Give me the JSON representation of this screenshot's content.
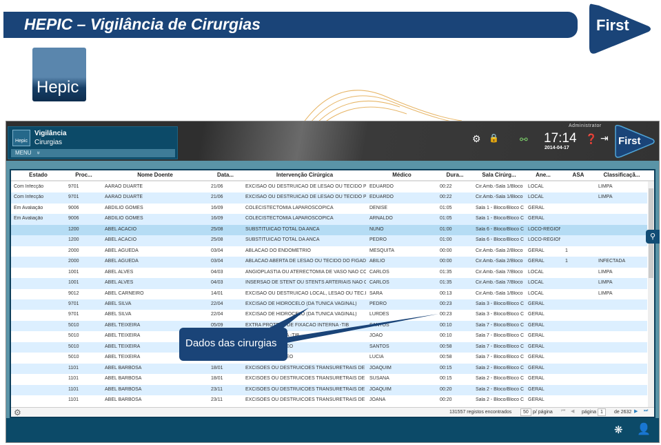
{
  "slide": {
    "title": "HEPIC – Vigilância de Cirurgias",
    "first_logo": "First",
    "hepic_logo": "Hepic",
    "callout": "Dados das cirurgias"
  },
  "app": {
    "module_icon": "Hepic",
    "module_title": "Vigilância",
    "module_subtitle": "Cirurgias",
    "menu_label": "MENU",
    "menu_chevron": "»",
    "user": "Administrator",
    "time": "17:14",
    "date": "2014-04-17",
    "logo": "First",
    "icons": [
      "gear-icon",
      "lock-icon",
      "network-icon",
      "help-icon",
      "logout-icon"
    ],
    "columns": [
      "Estado",
      "Proc...",
      "Nome Doente",
      "Data...",
      "Intervenção Cirúrgica",
      "Médico",
      "Dura...",
      "Sala Cirúrg...",
      "Ane...",
      "ASA",
      "Classificaçã..."
    ],
    "rows": [
      [
        "Com Infecção",
        "9701",
        "AARAO DUARTE",
        "21/06",
        "EXCISAO OU DESTRUICAO DE LESAO OU TECIDO PEI",
        "EDUARDO",
        "00:22",
        "Cir.Amb.-Sala 1/Bloco",
        "LOCAL",
        "",
        "LIMPA"
      ],
      [
        "Com Infecção",
        "9701",
        "AARAO DUARTE",
        "21/06",
        "EXCISAO OU DESTRUICAO DE LESAO OU TECIDO PEI",
        "EDUARDO",
        "00:22",
        "Cir.Amb.-Sala 1/Bloco",
        "LOCAL",
        "",
        "LIMPA"
      ],
      [
        "Em Avaliação",
        "9006",
        "ABDILIO GOMES",
        "16/09",
        "COLECISTECTOMIA LAPAROSCOPICA",
        "DENISE",
        "01:05",
        "Sala 1 - Bloco/Bloco C",
        "GERAL",
        "",
        ""
      ],
      [
        "Em Avaliação",
        "9006",
        "ABDILIO GOMES",
        "16/09",
        "COLECISTECTOMIA LAPAROSCOPICA",
        "ARNALDO",
        "01:05",
        "Sala 1 - Bloco/Bloco C",
        "GERAL",
        "",
        ""
      ],
      [
        "",
        "1200",
        "ABEL ACACIO",
        "25/08",
        "SUBSTITUICAO TOTAL DA ANCA",
        "NUNO",
        "01:00",
        "Sala 6 - Bloco/Bloco C",
        "LOCO-REGION",
        "",
        ""
      ],
      [
        "",
        "1200",
        "ABEL ACACIO",
        "25/08",
        "SUBSTITUICAO TOTAL DA ANCA",
        "PEDRO",
        "01:00",
        "Sala 6 - Bloco/Bloco C",
        "LOCO-REGION",
        "",
        ""
      ],
      [
        "",
        "2000",
        "ABEL AGUEDA",
        "03/04",
        "ABLACAO DO ENDOMETRIO",
        "MESQUITA",
        "00:00",
        "Cir.Amb.-Sala 2/Bloco",
        "GERAL",
        "1",
        ""
      ],
      [
        "",
        "2000",
        "ABEL AGUEDA",
        "03/04",
        "ABLACAO ABERTA DE LESAO OU TECIDO DO FIGADO",
        "ABILIO",
        "00:00",
        "Cir.Amb.-Sala 2/Bloco",
        "GERAL",
        "1",
        "INFECTADA"
      ],
      [
        "",
        "1001",
        "ABEL ALVES",
        "04/03",
        "ANGIOPLASTIA OU ATERECTOMIA DE VASO NAO CO",
        "CARLOS",
        "01:35",
        "Cir.Amb.-Sala 7/Bloco",
        "LOCAL",
        "",
        "LIMPA"
      ],
      [
        "",
        "1001",
        "ABEL ALVES",
        "04/03",
        "INSERSAO DE STENT OU STENTS ARTERIAIS NAO COI",
        "CARLOS",
        "01:35",
        "Cir.Amb.-Sala 7/Bloco",
        "LOCAL",
        "",
        "LIMPA"
      ],
      [
        "",
        "9012",
        "ABEL CARNEIRO",
        "14/01",
        "EXCISAO OU DESTRUICAO LOCAL, LESAO OU TEC.PE",
        "SARA",
        "00:13",
        "Cir.Amb.-Sala 1/Bloco",
        "LOCAL",
        "",
        "LIMPA"
      ],
      [
        "",
        "9701",
        "ABEL SILVA",
        "22/04",
        "EXCISAO DE HIDROCELO (DA TUNICA VAGINAL)",
        "PEDRO",
        "00:23",
        "Sala 3 - Bloco/Bloco C",
        "GERAL",
        "",
        ""
      ],
      [
        "",
        "9701",
        "ABEL SILVA",
        "22/04",
        "EXCISAO DE HIDROCELO (DA TUNICA VAGINAL)",
        "LURDES",
        "00:23",
        "Sala 3 - Bloco/Bloco C",
        "GERAL",
        "",
        ""
      ],
      [
        "",
        "5010",
        "ABEL TEIXEIRA",
        "05/09",
        "EXTRA PROTESE DE FIXACAO INTERNA -TIB",
        "SANTOS",
        "00:10",
        "Sala 7 - Bloco/Bloco C",
        "GERAL",
        "",
        ""
      ],
      [
        "",
        "5010",
        "ABEL TEIXEIRA",
        "",
        "FIXACAO INTERNA -TIB",
        "JOAO",
        "00:10",
        "Sala 7 - Bloco/Bloco C",
        "GERAL",
        "",
        ""
      ],
      [
        "",
        "5010",
        "ABEL TEIXEIRA",
        "",
        "A -TIBIA E PERONEO",
        "SANTOS",
        "00:58",
        "Sala 7 - Bloco/Bloco C",
        "GERAL",
        "",
        ""
      ],
      [
        "",
        "5010",
        "ABEL TEIXEIRA",
        "",
        "A -TIBIA E PERONEO",
        "LUCIA",
        "00:58",
        "Sala 7 - Bloco/Bloco C",
        "GERAL",
        "",
        ""
      ],
      [
        "",
        "1101",
        "ABEL BARBOSA",
        "18/01",
        "EXCISOES OU DESTRUICOES TRANSURETRAIS DE LES",
        "JOAQUIM",
        "00:15",
        "Sala 2 - Bloco/Bloco C",
        "GERAL",
        "",
        ""
      ],
      [
        "",
        "1101",
        "ABEL BARBOSA",
        "18/01",
        "EXCISOES OU DESTRUICOES TRANSURETRAIS DE LES",
        "SUSANA",
        "00:15",
        "Sala 2 - Bloco/Bloco C",
        "GERAL",
        "",
        ""
      ],
      [
        "",
        "1101",
        "ABEL BARBOSA",
        "23/11",
        "EXCISOES OU DESTRUICOES TRANSURETRAIS DE LES",
        "JOAQUIM",
        "00:20",
        "Sala 2 - Bloco/Bloco C",
        "GERAL",
        "",
        ""
      ],
      [
        "",
        "1101",
        "ABEL BARBOSA",
        "23/11",
        "EXCISOES OU DESTRUICOES TRANSURETRAIS DE LES",
        "JOANA",
        "00:20",
        "Sala 2 - Bloco/Bloco C",
        "GERAL",
        "",
        ""
      ]
    ],
    "selected_row": 4,
    "footer": {
      "records": "131557 registos encontrados",
      "per_page_value": "50",
      "per_page_label": "p/ página",
      "page_label": "página",
      "page_value": "1",
      "page_total": "de 2632"
    },
    "colors": {
      "brand": "#1a4478",
      "panel": "#0c4a68",
      "row_alt": "#dcefff",
      "row_selected": "#b5dcf4"
    }
  }
}
